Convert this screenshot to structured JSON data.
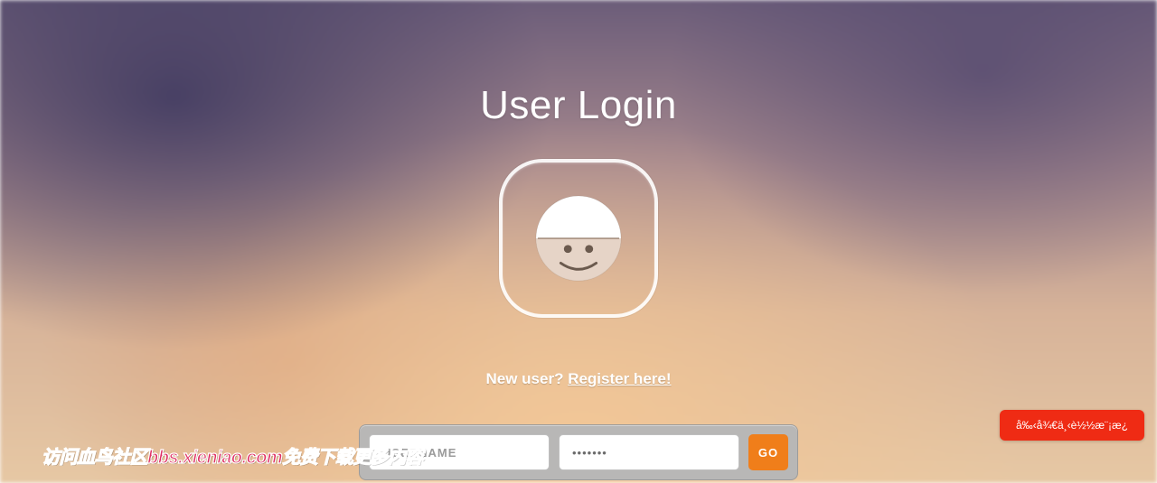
{
  "title": "User Login",
  "new_user_prefix": "New user? ",
  "register_link": "Register here!",
  "form": {
    "username_placeholder": "USERNAME",
    "password_value": "•••••••",
    "go_label": "GO"
  },
  "side_button_label": "å‰‹å¾€ä¸‹è½½æ¨¡æ¿",
  "watermark_text": "访问血鸟社区bbs.xieniao.com免费下载更多内容"
}
